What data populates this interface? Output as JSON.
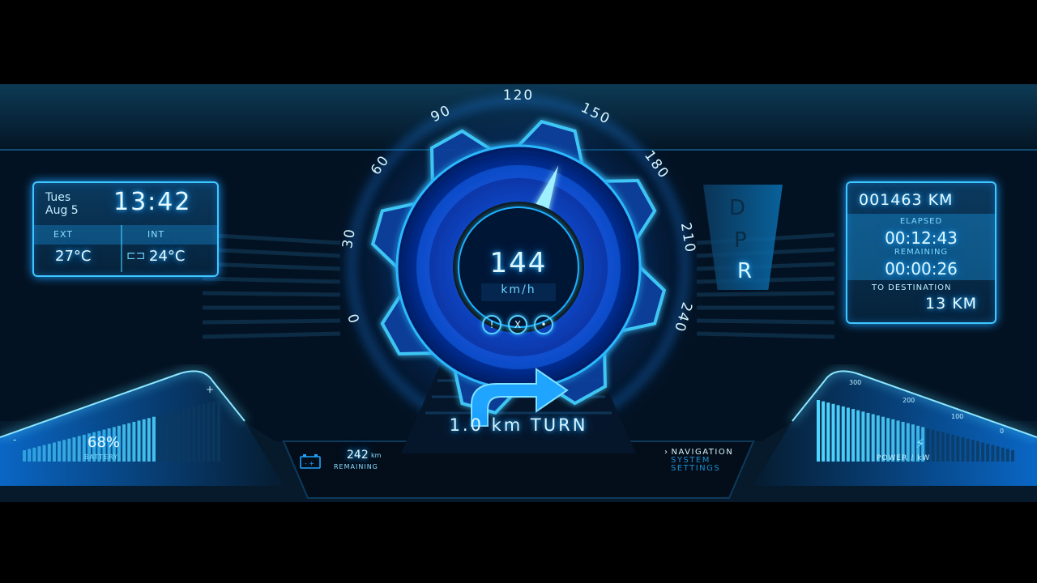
{
  "clock": {
    "day": "Tues",
    "date": "Aug 5",
    "time": "13:42"
  },
  "temperature": {
    "ext_label": "EXT",
    "ext_value": "27°C",
    "int_label": "INT",
    "int_value": "24°C"
  },
  "speedometer": {
    "speed": "144",
    "unit": "km/h",
    "ticks": [
      "0",
      "30",
      "60",
      "90",
      "120",
      "150",
      "180",
      "210",
      "240"
    ],
    "needle_value": 144,
    "scale_max": 240,
    "status_icons": [
      "warning-icon",
      "cancel-icon",
      "record-icon"
    ],
    "status_glyphs": [
      "!",
      "X",
      "•"
    ]
  },
  "gear": {
    "options": [
      "D",
      "P",
      "R"
    ]
  },
  "trip": {
    "odometer": "001463 KM",
    "elapsed_label": "ELAPSED",
    "elapsed": "00:12:43",
    "remaining_label": "REMAINING",
    "remaining": "00:00:26",
    "destination_label": "TO DESTINATION",
    "destination": "13 KM"
  },
  "battery": {
    "percent": "68%",
    "label": "BATTERY",
    "level": 0.68,
    "plus": "+",
    "minus": "-"
  },
  "range": {
    "value": "242",
    "unit": "km",
    "label": "REMAINING"
  },
  "navigation": {
    "instruction": "1.0 km TURN",
    "arrow": "turn-right-arrow-icon"
  },
  "menu": {
    "items": [
      "NAVIGATION",
      "SYSTEM",
      "SETTINGS"
    ],
    "active": "NAVIGATION",
    "marker": "›"
  },
  "power": {
    "label": "POWER / kW",
    "ticks": [
      "300",
      "200",
      "100",
      "0"
    ],
    "level": 0.55
  },
  "colors": {
    "accent": "#3fc8ff",
    "dark": "#06223a",
    "glow": "#1a9cff"
  }
}
